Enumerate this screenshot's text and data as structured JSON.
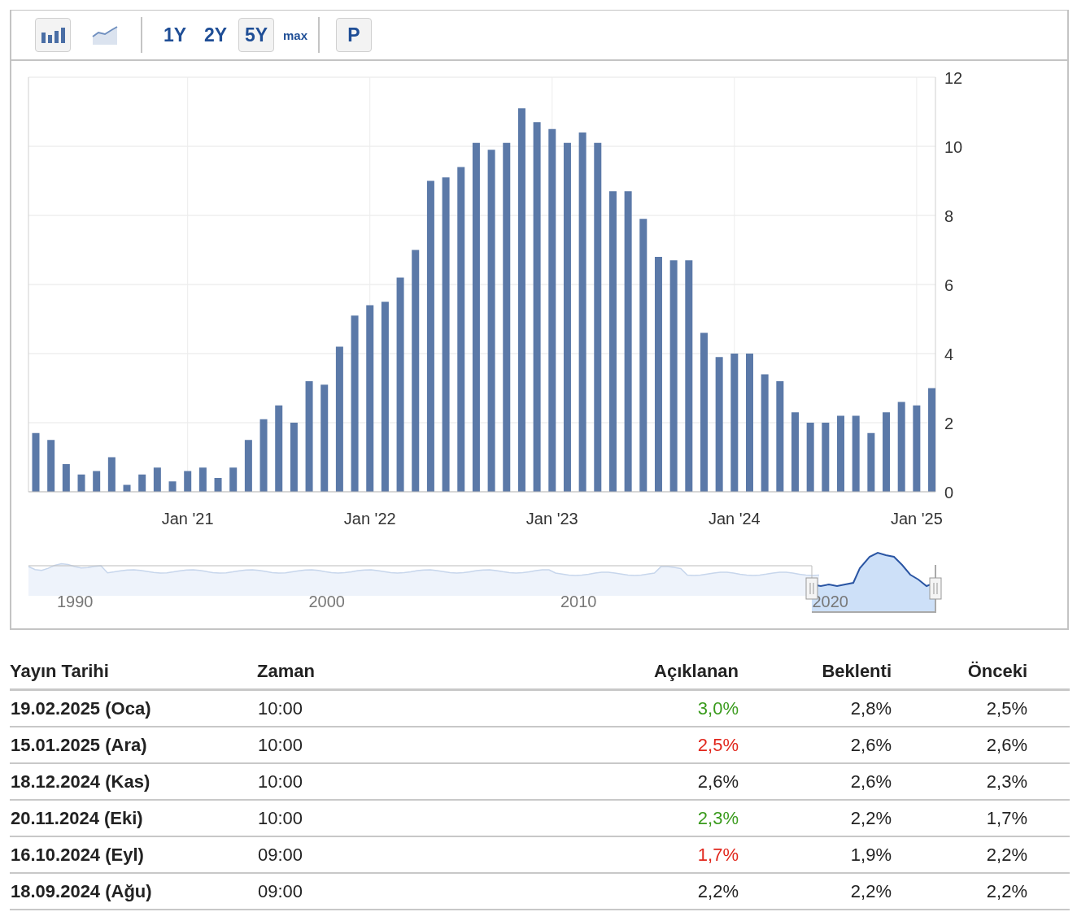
{
  "toolbar": {
    "chart_types": [
      {
        "kind": "bar",
        "selected": true
      },
      {
        "kind": "area",
        "selected": false
      }
    ],
    "ranges": [
      {
        "label": "1Y",
        "selected": false,
        "compact": false
      },
      {
        "label": "2Y",
        "selected": false,
        "compact": false
      },
      {
        "label": "5Y",
        "selected": true,
        "compact": false
      },
      {
        "label": "max",
        "selected": false,
        "compact": true
      }
    ],
    "extra_button": "P"
  },
  "chart": {
    "chart_data": {
      "type": "bar",
      "categories": [
        null,
        null,
        null,
        null,
        null,
        null,
        null,
        null,
        null,
        null,
        "Jan '21",
        null,
        null,
        null,
        null,
        null,
        null,
        null,
        null,
        null,
        null,
        null,
        "Jan '22",
        null,
        null,
        null,
        null,
        null,
        null,
        null,
        null,
        null,
        null,
        null,
        "Jan '23",
        null,
        null,
        null,
        null,
        null,
        null,
        null,
        null,
        null,
        null,
        null,
        "Jan '24",
        null,
        null,
        null,
        null,
        null,
        null,
        null,
        null,
        null,
        null,
        null,
        "Jan '25",
        null
      ],
      "grid": true,
      "series": [
        {
          "color": "#5b79a8",
          "values": [
            1.7,
            1.5,
            0.8,
            0.5,
            0.6,
            1.0,
            0.2,
            0.5,
            0.7,
            0.3,
            0.6,
            0.7,
            0.4,
            0.7,
            1.5,
            2.1,
            2.5,
            2.0,
            3.2,
            3.1,
            4.2,
            5.1,
            5.4,
            5.5,
            6.2,
            7.0,
            9.0,
            9.1,
            9.4,
            10.1,
            9.9,
            10.1,
            11.1,
            10.7,
            10.5,
            10.1,
            10.4,
            10.1,
            8.7,
            8.7,
            7.9,
            6.8,
            6.7,
            6.7,
            4.6,
            3.9,
            4.0,
            4.0,
            3.4,
            3.2,
            2.3,
            2.0,
            2.0,
            2.2,
            2.2,
            1.7,
            2.3,
            2.6,
            2.5,
            3.0
          ]
        }
      ],
      "ylim": [
        0,
        12
      ],
      "yticks": [
        0,
        2,
        4,
        6,
        8,
        10,
        12
      ]
    }
  },
  "navigator": {
    "year_labels": [
      "1990",
      "2000",
      "2010",
      "2020"
    ]
  },
  "table": {
    "columns": [
      "Yayın Tarihi",
      "Zaman",
      "Açıklanan",
      "Beklenti",
      "Önceki"
    ],
    "rows": [
      {
        "date": "19.02.2025 (Oca)",
        "time": "10:00",
        "actual": "3,0%",
        "color": "#3a9b1d",
        "forecast": "2,8%",
        "previous": "2,5%"
      },
      {
        "date": "15.01.2025 (Ara)",
        "time": "10:00",
        "actual": "2,5%",
        "color": "#e1261c",
        "forecast": "2,6%",
        "previous": "2,6%"
      },
      {
        "date": "18.12.2024 (Kas)",
        "time": "10:00",
        "actual": "2,6%",
        "color": "#222222",
        "forecast": "2,6%",
        "previous": "2,3%"
      },
      {
        "date": "20.11.2024 (Eki)",
        "time": "10:00",
        "actual": "2,3%",
        "color": "#3a9b1d",
        "forecast": "2,2%",
        "previous": "1,7%"
      },
      {
        "date": "16.10.2024 (Eyl)",
        "time": "09:00",
        "actual": "1,7%",
        "color": "#e1261c",
        "forecast": "1,9%",
        "previous": "2,2%"
      },
      {
        "date": "18.09.2024 (Ağu)",
        "time": "09:00",
        "actual": "2,2%",
        "color": "#222222",
        "forecast": "2,2%",
        "previous": "2,2%"
      }
    ]
  }
}
